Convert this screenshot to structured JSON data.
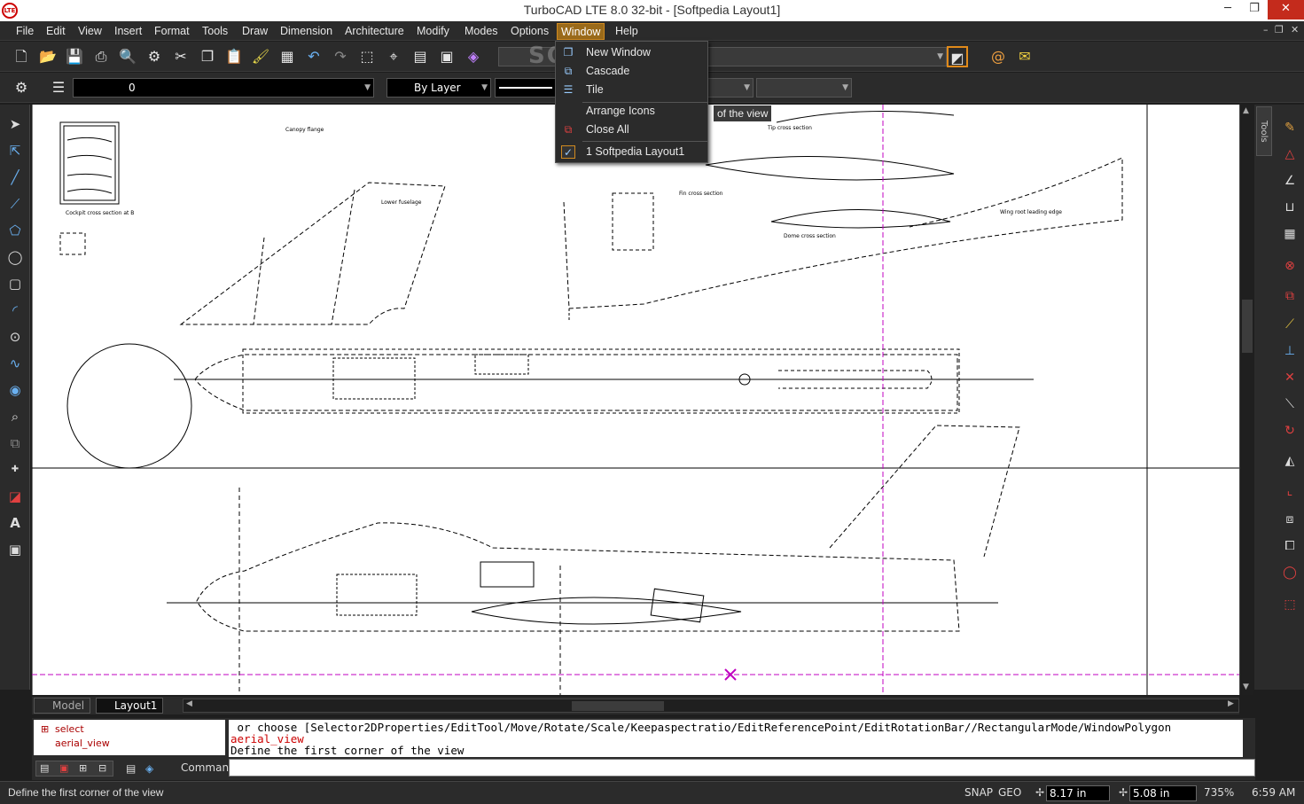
{
  "window": {
    "title": "TurboCAD LTE 8.0 32-bit - [Softpedia Layout1]",
    "app_icon": "LTE",
    "minimize": "─",
    "restore": "❐",
    "close": "✕"
  },
  "menu": {
    "items": [
      "File",
      "Edit",
      "View",
      "Insert",
      "Format",
      "Tools",
      "Draw",
      "Dimension",
      "Architecture",
      "Modify",
      "Modes",
      "Options",
      "Window",
      "Help"
    ],
    "active": "Window",
    "mdi_min": "–",
    "mdi_restore": "❐",
    "mdi_close": "✕"
  },
  "toolbar2": {
    "layer_value": "0",
    "color_value": "By Layer",
    "layer_dim": "By Layer"
  },
  "window_menu": {
    "items": [
      "New Window",
      "Cascade",
      "Tile",
      "Arrange Icons",
      "Close All",
      "1 Softpedia Layout1"
    ]
  },
  "tooltip": "of the view",
  "watermark": "SOFTPEDIA",
  "right_panel": {
    "tab_label": "Tools"
  },
  "tabs": {
    "model": "Model",
    "layout": "Layout1"
  },
  "drawing_labels": {
    "a": "Cockpit cross section at B",
    "b": "Canopy flange",
    "c": "Lower fuselage",
    "d": "Fin cross section",
    "e": "Wing root leading edge",
    "f": "Tip cross section",
    "g": "Dome cross section"
  },
  "command": {
    "tree": [
      "select",
      "aerial_view"
    ],
    "log_line1": " or choose [Selector2DProperties/EditTool/Move/Rotate/Scale/Keepaspectratio/EditReferencePoint/EditRotationBar//RectangularMode/WindowPolygon",
    "log_line2": "aerial_view",
    "log_line3": "Define the first corner of the view",
    "label": "Command:"
  },
  "status": {
    "message": "Define the first corner of the view",
    "snap": "SNAP",
    "geo": "GEO",
    "x": "8.17 in",
    "y": "5.08 in",
    "zoom": "735%",
    "time": "6:59 AM"
  }
}
